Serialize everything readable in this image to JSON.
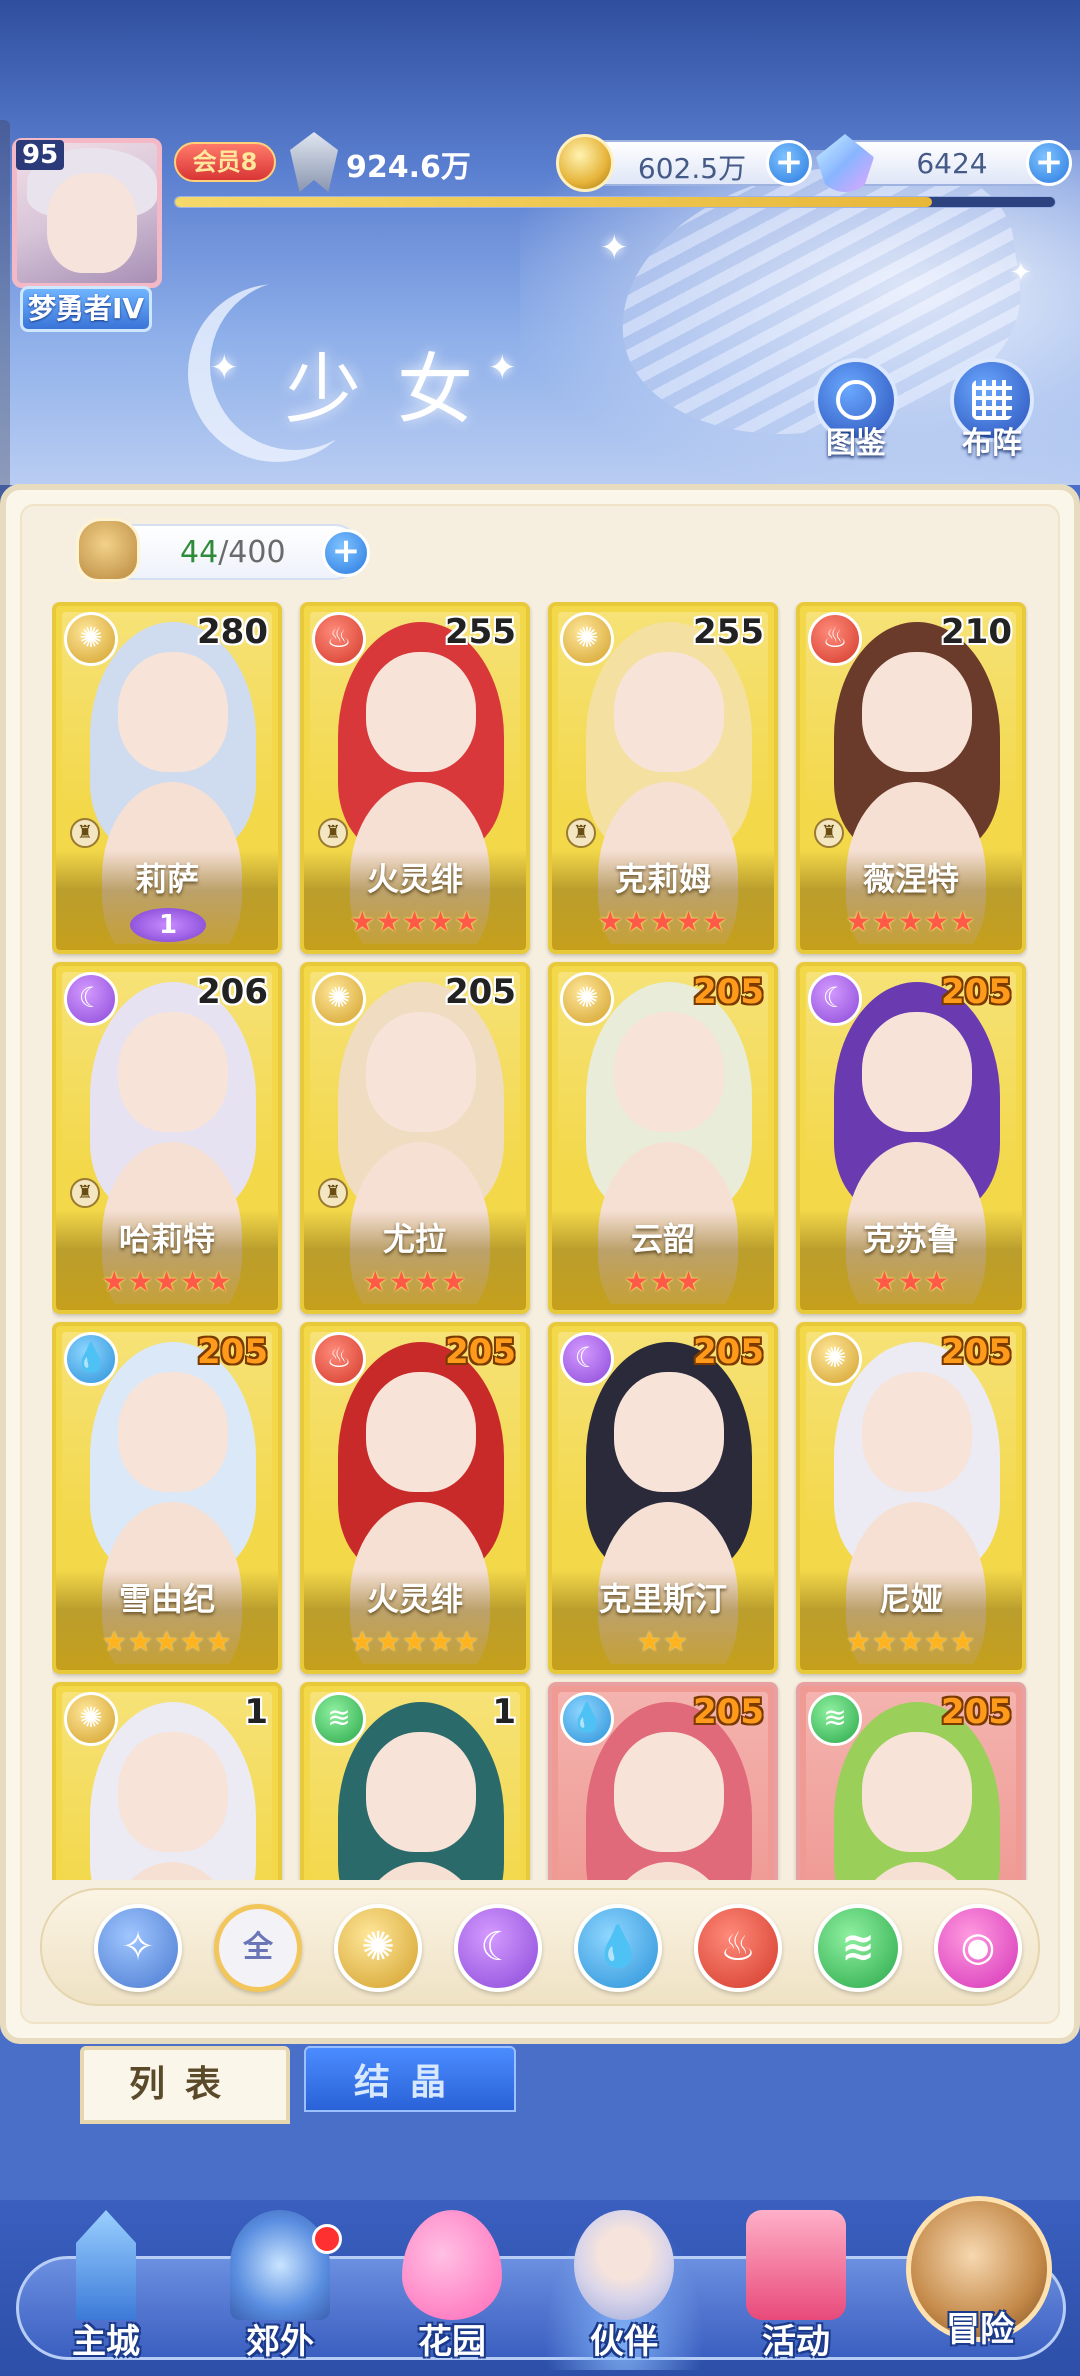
{
  "player": {
    "level": "95",
    "title": "梦勇者IV",
    "vip": "会员8",
    "power": "924.6万",
    "coins": "602.5万",
    "gems": "6424",
    "exp_fraction": 0.86
  },
  "page": {
    "title": "少女",
    "codex_label": "图鉴",
    "formation_label": "布阵"
  },
  "roster": {
    "count": "44",
    "capacity": "400",
    "cards": [
      {
        "name": "莉萨",
        "level": "280",
        "element": "light",
        "stars": "",
        "wing": "1",
        "role": "♜"
      },
      {
        "name": "火灵绯",
        "level": "255",
        "element": "fire",
        "stars": "★★★★★",
        "role": "♜"
      },
      {
        "name": "克莉姆",
        "level": "255",
        "element": "light",
        "stars": "★★★★★",
        "role": "♜"
      },
      {
        "name": "薇涅特",
        "level": "210",
        "element": "fire",
        "stars": "★★★★★",
        "role": "♜"
      },
      {
        "name": "哈莉特",
        "level": "206",
        "element": "moon",
        "stars": "★★★★★",
        "role": "♜"
      },
      {
        "name": "尤拉",
        "level": "205",
        "element": "light",
        "stars": "★★★★",
        "role": "♜"
      },
      {
        "name": "云韶",
        "level": "205",
        "element": "light",
        "stars": "★★★"
      },
      {
        "name": "克苏鲁",
        "level": "205",
        "element": "moon",
        "stars": "★★★"
      },
      {
        "name": "雪由纪",
        "level": "205",
        "element": "water",
        "stars": "★★★★★"
      },
      {
        "name": "火灵绯",
        "level": "205",
        "element": "fire",
        "stars": "★★★★★"
      },
      {
        "name": "克里斯汀",
        "level": "205",
        "element": "moon",
        "stars": "★★"
      },
      {
        "name": "尼娅",
        "level": "205",
        "element": "light",
        "stars": "★★★★★"
      },
      {
        "name": "",
        "level": "1",
        "element": "light",
        "stars": ""
      },
      {
        "name": "",
        "level": "1",
        "element": "wind",
        "stars": ""
      },
      {
        "name": "",
        "level": "205",
        "element": "water",
        "stars": "",
        "frame": "red"
      },
      {
        "name": "",
        "level": "205",
        "element": "wind",
        "stars": "",
        "frame": "red"
      }
    ]
  },
  "filters": [
    {
      "icon": "star-compass-icon",
      "label": ""
    },
    {
      "icon": "all-icon",
      "label": "全"
    },
    {
      "icon": "sun-icon",
      "label": ""
    },
    {
      "icon": "moon-icon",
      "label": ""
    },
    {
      "icon": "water-drop-icon",
      "label": ""
    },
    {
      "icon": "fire-icon",
      "label": ""
    },
    {
      "icon": "wind-icon",
      "label": ""
    },
    {
      "icon": "planet-icon",
      "label": ""
    }
  ],
  "tabs": {
    "list": "列表",
    "crystal": "结晶"
  },
  "nav": {
    "main_city": "主城",
    "suburbs": "郊外",
    "garden": "花园",
    "partners": "伙伴",
    "events": "活动",
    "adventure": "冒险"
  },
  "colors": {
    "card_gold": "#f3d84a",
    "card_red": "#f09a94",
    "star_red": "#ff5a48",
    "star_gold": "#ffb41f",
    "level_orange": "#ff9a1a"
  }
}
